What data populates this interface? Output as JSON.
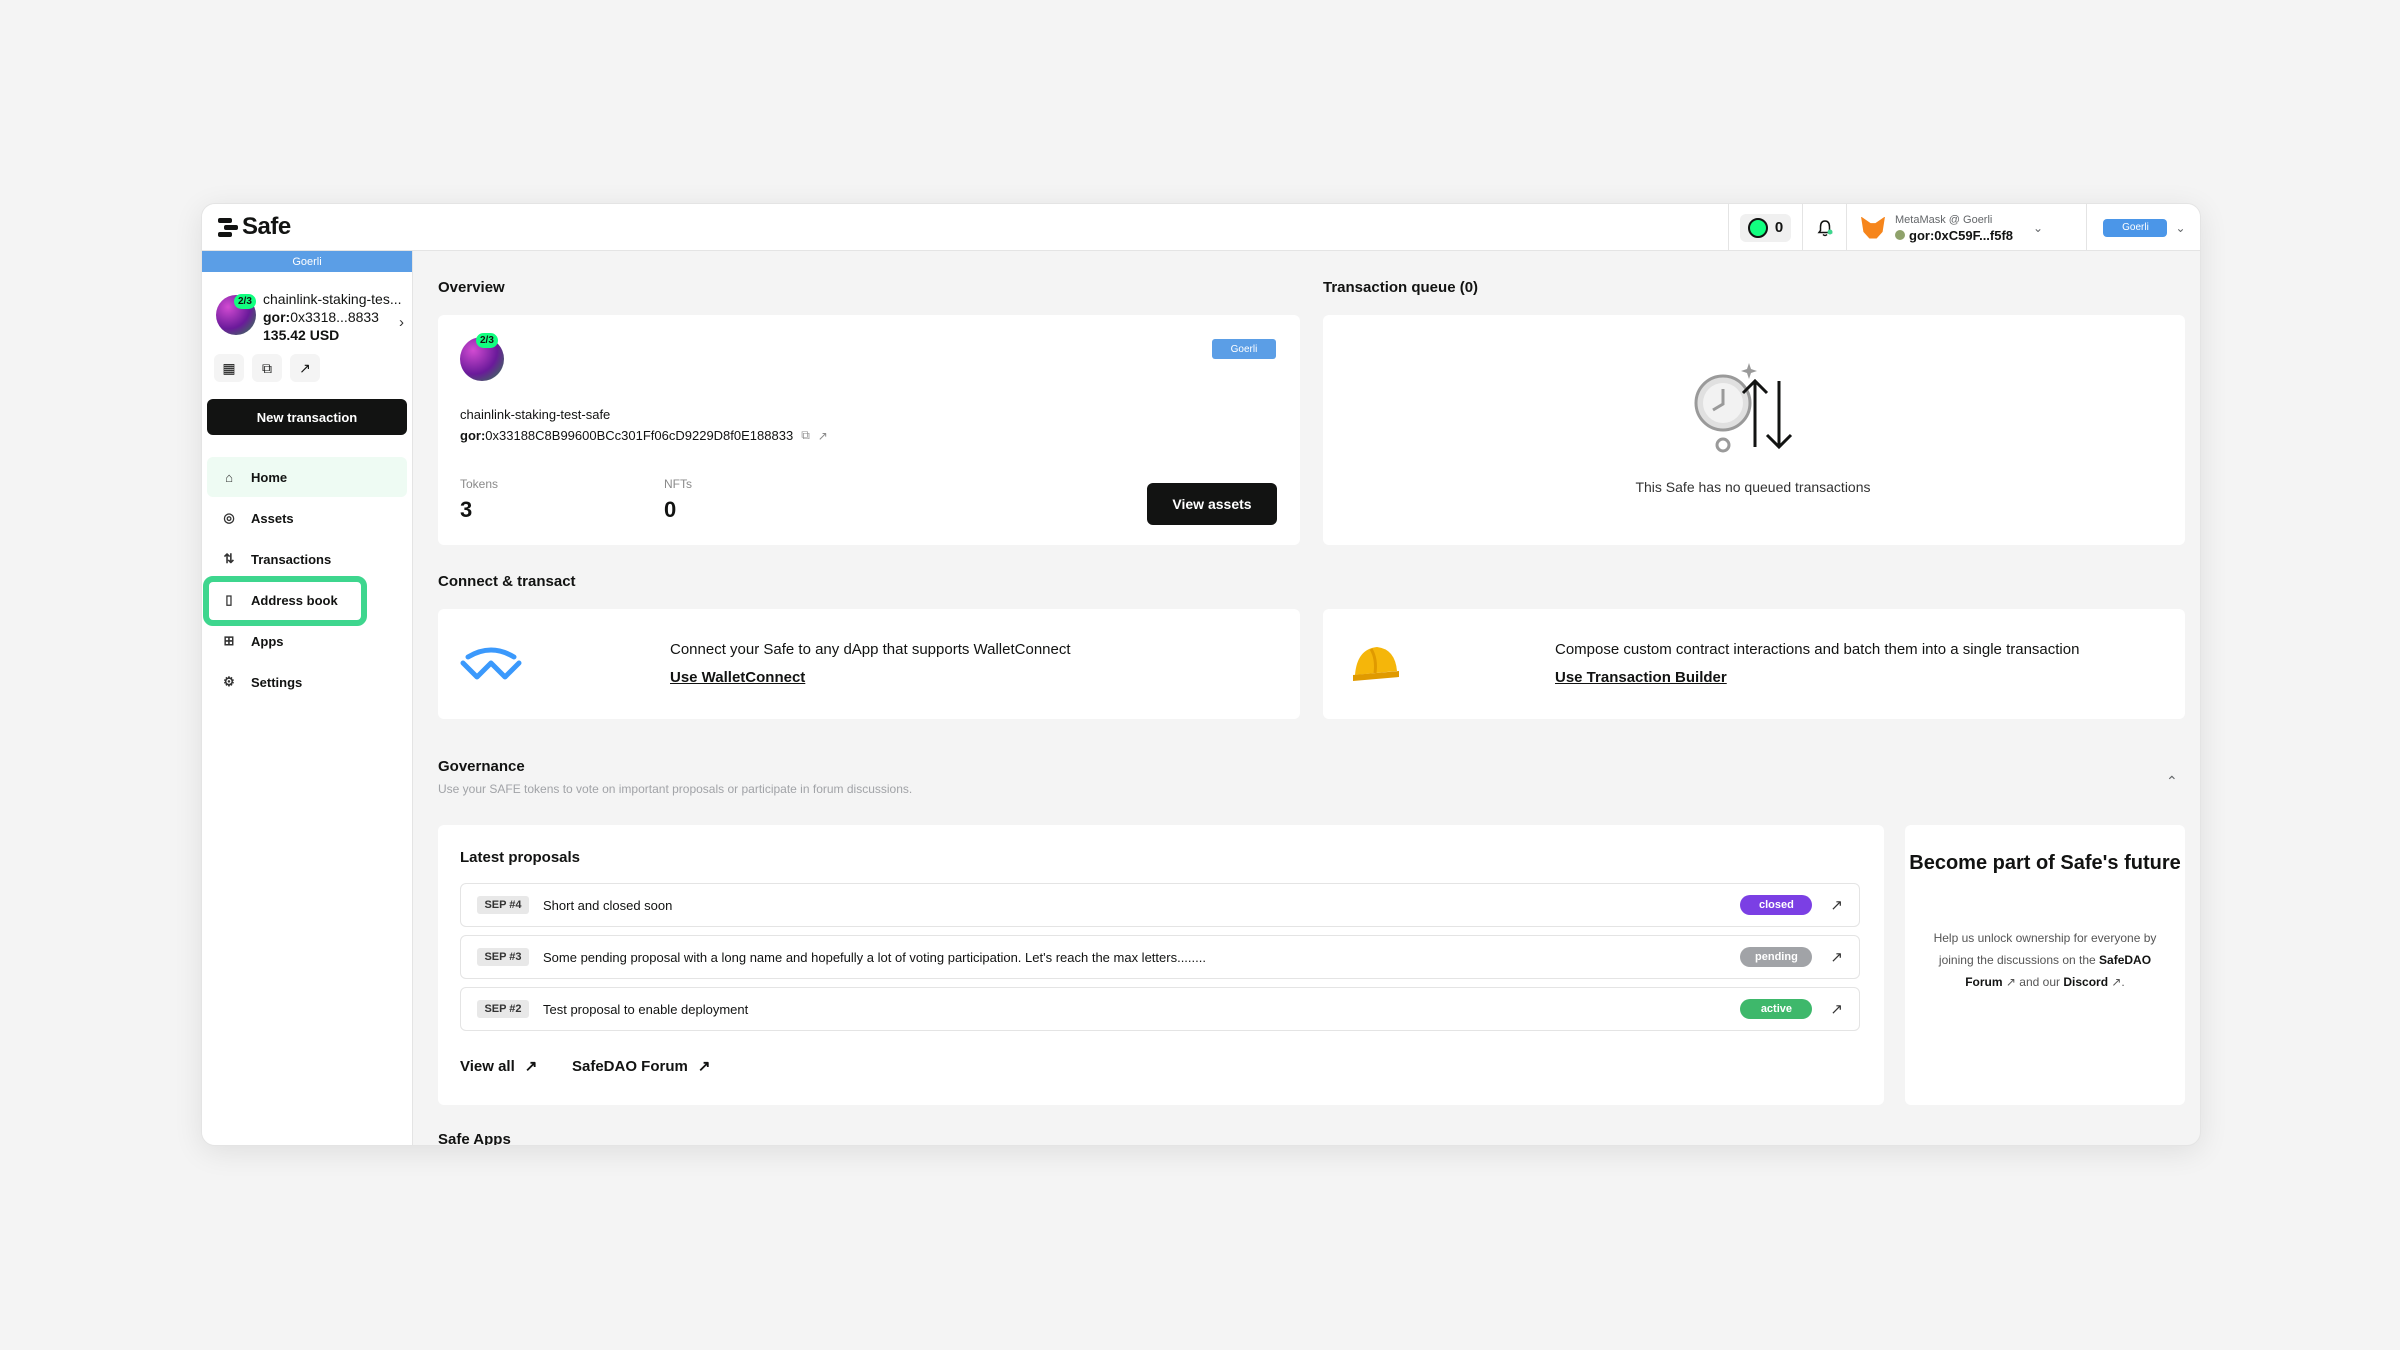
{
  "header": {
    "logo_text": "Safe",
    "gas_count": "0",
    "wallet_label": "MetaMask @ Goerli",
    "wallet_address": "gor:0xC59F...f5f8",
    "network": "Goerli"
  },
  "sidebar": {
    "network": "Goerli",
    "threshold": "2/3",
    "safe_name": "chainlink-staking-tes...",
    "safe_address_prefix": "gor:",
    "safe_address": "0x3318...8833",
    "balance": "135.42 USD",
    "new_tx_label": "New transaction",
    "items": [
      {
        "label": "Home",
        "icon": "home-icon",
        "glyph": "⌂"
      },
      {
        "label": "Assets",
        "icon": "assets-icon",
        "glyph": "◎"
      },
      {
        "label": "Transactions",
        "icon": "transactions-icon",
        "glyph": "⇅"
      },
      {
        "label": "Address book",
        "icon": "address-book-icon",
        "glyph": "▯"
      },
      {
        "label": "Apps",
        "icon": "apps-icon",
        "glyph": "⊞"
      },
      {
        "label": "Settings",
        "icon": "settings-icon",
        "glyph": "⚙"
      }
    ]
  },
  "overview": {
    "title": "Overview",
    "network": "Goerli",
    "threshold": "2/3",
    "safe_name": "chainlink-staking-test-safe",
    "address_prefix": "gor:",
    "address": "0x33188C8B99600BCc301Ff06cD9229D8f0E188833",
    "tokens_label": "Tokens",
    "tokens_value": "3",
    "nfts_label": "NFTs",
    "nfts_value": "0",
    "view_assets": "View assets"
  },
  "queue": {
    "title": "Transaction queue (0)",
    "empty_text": "This Safe has no queued transactions"
  },
  "connect": {
    "title": "Connect & transact",
    "walletconnect_text": "Connect your Safe to any dApp that supports WalletConnect",
    "walletconnect_link": "Use WalletConnect",
    "builder_text": "Compose custom contract interactions and batch them into a single transaction",
    "builder_link": "Use Transaction Builder"
  },
  "governance": {
    "title": "Governance",
    "subtitle": "Use your SAFE tokens to vote on important proposals or participate in forum discussions.",
    "proposals_title": "Latest proposals",
    "proposals": [
      {
        "sep": "SEP #4",
        "title": "Short and closed soon",
        "status": "closed",
        "color": "#7b3fe4"
      },
      {
        "sep": "SEP #3",
        "title": "Some pending proposal with a long name and hopefully a lot of voting participation. Let's reach the max letters........",
        "status": "pending",
        "color": "#a1a3a7"
      },
      {
        "sep": "SEP #2",
        "title": "Test proposal to enable deployment",
        "status": "active",
        "color": "#3eb86b"
      }
    ],
    "view_all": "View all",
    "forum_link": "SafeDAO Forum",
    "join_title": "Become part of Safe's future",
    "join_text_1": "Help us unlock ownership for everyone by joining the discussions on the",
    "join_forum": "SafeDAO Forum",
    "join_and": "and our",
    "join_discord": "Discord"
  },
  "safe_apps_title": "Safe Apps"
}
